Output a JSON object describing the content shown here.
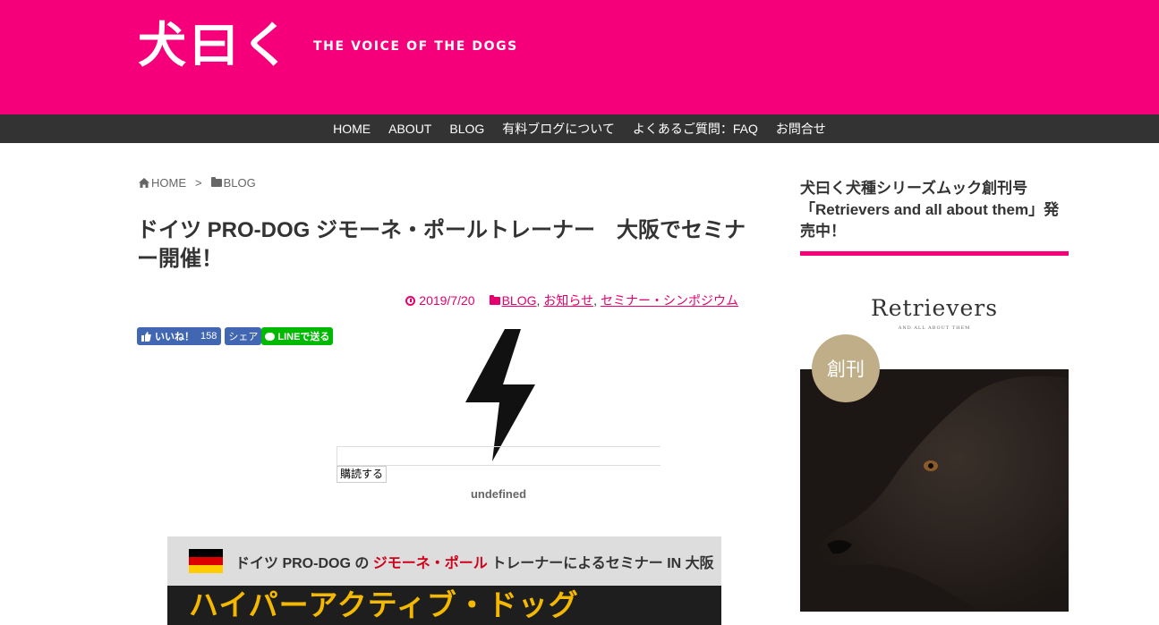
{
  "header": {
    "logo": "犬曰く",
    "tagline": "THE VOICE OF THE DOGS",
    "brand_color": "#f5007a"
  },
  "nav": {
    "items": [
      "HOME",
      "ABOUT",
      "BLOG",
      "有料ブログについて",
      "よくあるご質問：FAQ",
      "お問合せ"
    ]
  },
  "breadcrumb": {
    "home": "HOME",
    "home_icon": "home-icon",
    "separator": ">",
    "category": "BLOG",
    "category_icon": "folder-icon"
  },
  "post": {
    "title": "ドイツ PRO-DOG ジモーネ・ポールトレーナー　大阪でセミナー開催！",
    "date": "2019/7/20",
    "categories": [
      "BLOG",
      "お知らせ",
      "セミナー・シンポジウム"
    ]
  },
  "share": {
    "like_label": "いいね！",
    "like_count": "158",
    "share_label": "シェア",
    "line_label": "LINEで送る"
  },
  "subscribe": {
    "icon": "lightning-icon",
    "button_label": "購読する",
    "status_text": "undefined"
  },
  "banner": {
    "line_prefix": "ドイツ PRO-DOG の ",
    "line_highlight": "ジモーネ・ポール",
    "line_suffix": " トレーナーによるセミナー IN 大阪",
    "catch": "ハイパーアクティブ・ドッグ"
  },
  "sidebar": {
    "widget_title": "犬曰く犬種シリーズムック創刊号「Retrievers and all about them」発売中！",
    "book_title": "Retrievers",
    "book_subtitle": "AND ALL ABOUT THEM",
    "book_badge": "創刊"
  }
}
